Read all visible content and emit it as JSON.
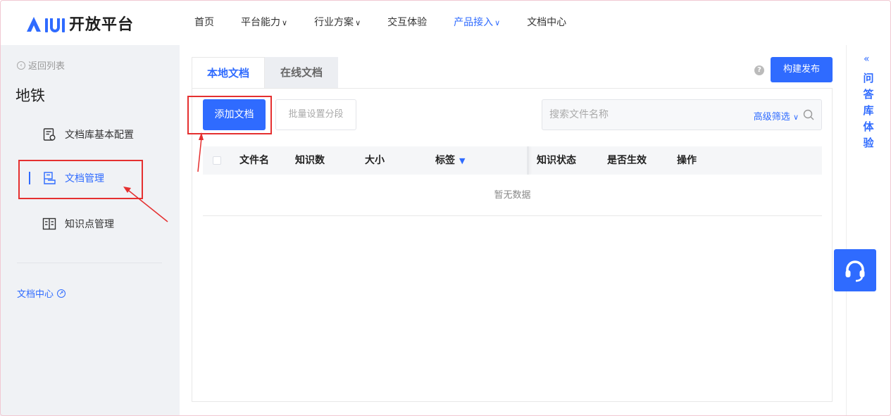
{
  "header": {
    "logo_text": "开放平台",
    "nav": [
      {
        "label": "首页",
        "caret": ""
      },
      {
        "label": "平台能力",
        "caret": "∨"
      },
      {
        "label": "行业方案",
        "caret": "∨"
      },
      {
        "label": "交互体验",
        "caret": ""
      },
      {
        "label": "产品接入",
        "caret": "∨"
      },
      {
        "label": "文档中心",
        "caret": ""
      }
    ]
  },
  "sidebar": {
    "back_label": "返回列表",
    "library_title": "地铁",
    "items": [
      {
        "label": "文档库基本配置"
      },
      {
        "label": "文档管理"
      },
      {
        "label": "知识点管理"
      }
    ],
    "doc_center_label": "文档中心"
  },
  "main": {
    "tabs": [
      {
        "label": "本地文档"
      },
      {
        "label": "在线文档"
      }
    ],
    "publish_label": "构建发布",
    "add_doc_label": "添加文档",
    "batch_label": "批量设置分段",
    "search_placeholder": "搜索文件名称",
    "advanced_filter_label": "高级筛选",
    "table": {
      "columns": [
        "文件名",
        "知识数",
        "大小",
        "标签",
        "知识状态",
        "是否生效",
        "操作"
      ],
      "empty_text": "暂无数据"
    }
  },
  "right_panel": {
    "collapse_label": "«",
    "vertical_label": [
      "问",
      "答",
      "库",
      "体",
      "验"
    ]
  },
  "colors": {
    "accent": "#2f6bff",
    "annotation": "#e53030"
  }
}
